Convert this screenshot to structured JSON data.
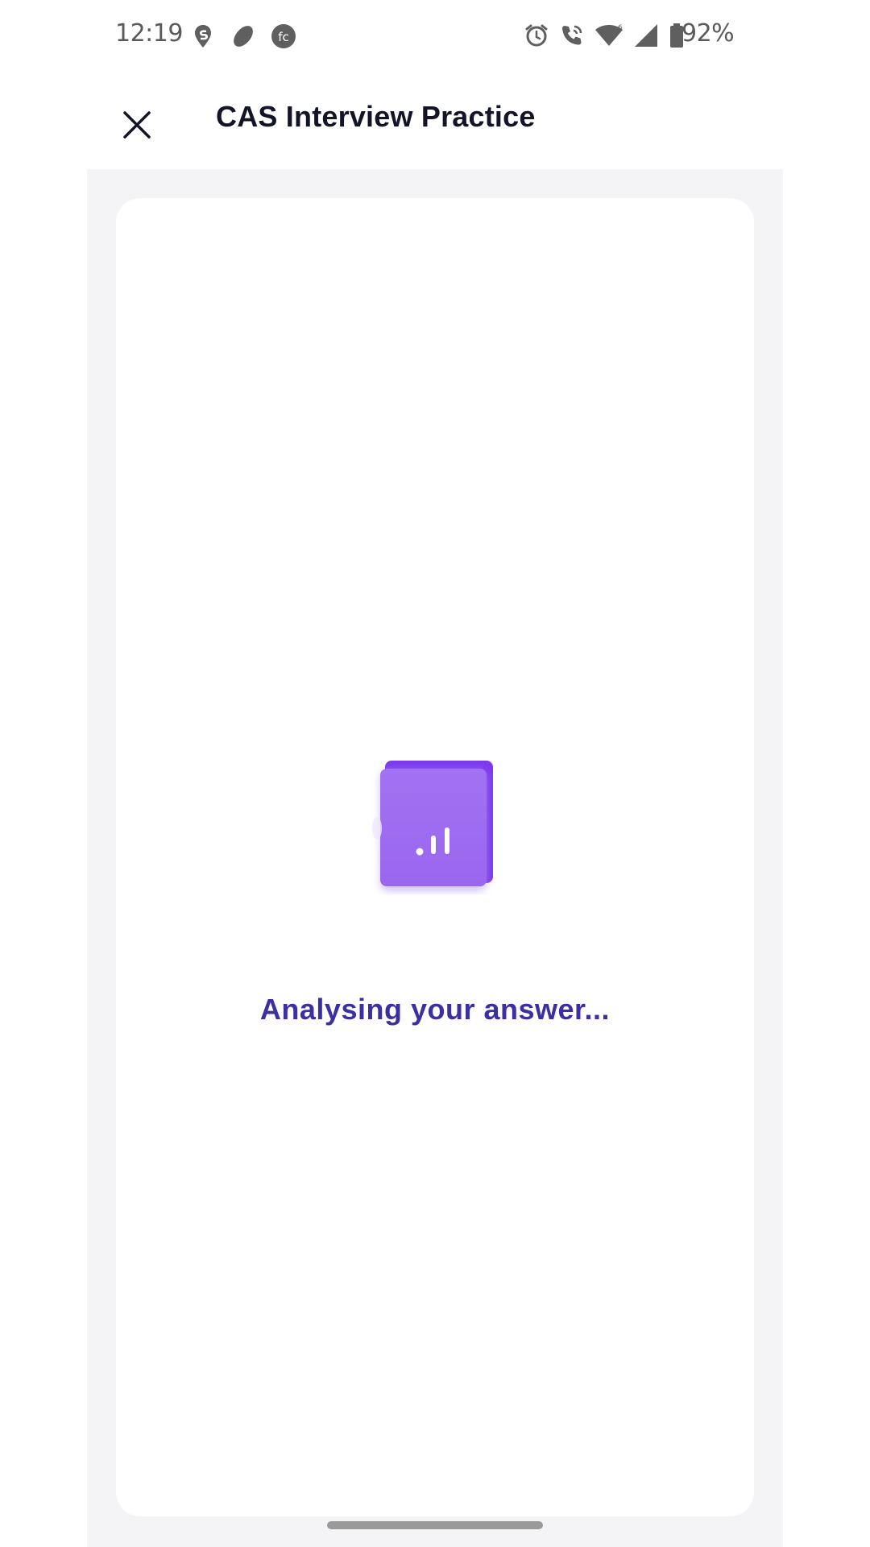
{
  "status_bar": {
    "time": "12:19",
    "battery_percent": "92%",
    "left_icons": [
      "swiggy-icon",
      "leaf-icon",
      "fc-icon"
    ],
    "right_icons": [
      "alarm-icon",
      "wifi-call-icon",
      "wifi-icon",
      "signal-icon",
      "battery-icon"
    ]
  },
  "header": {
    "title": "CAS Interview Practice",
    "close_icon": "close-icon"
  },
  "main": {
    "illustration_icon": "analysis-chart-icon",
    "status_message": "Analysing your answer..."
  },
  "colors": {
    "accent_purple": "#8a5cf0",
    "message_text": "#3b2fa4",
    "title_text": "#141428",
    "content_background": "#f4f4f6"
  }
}
